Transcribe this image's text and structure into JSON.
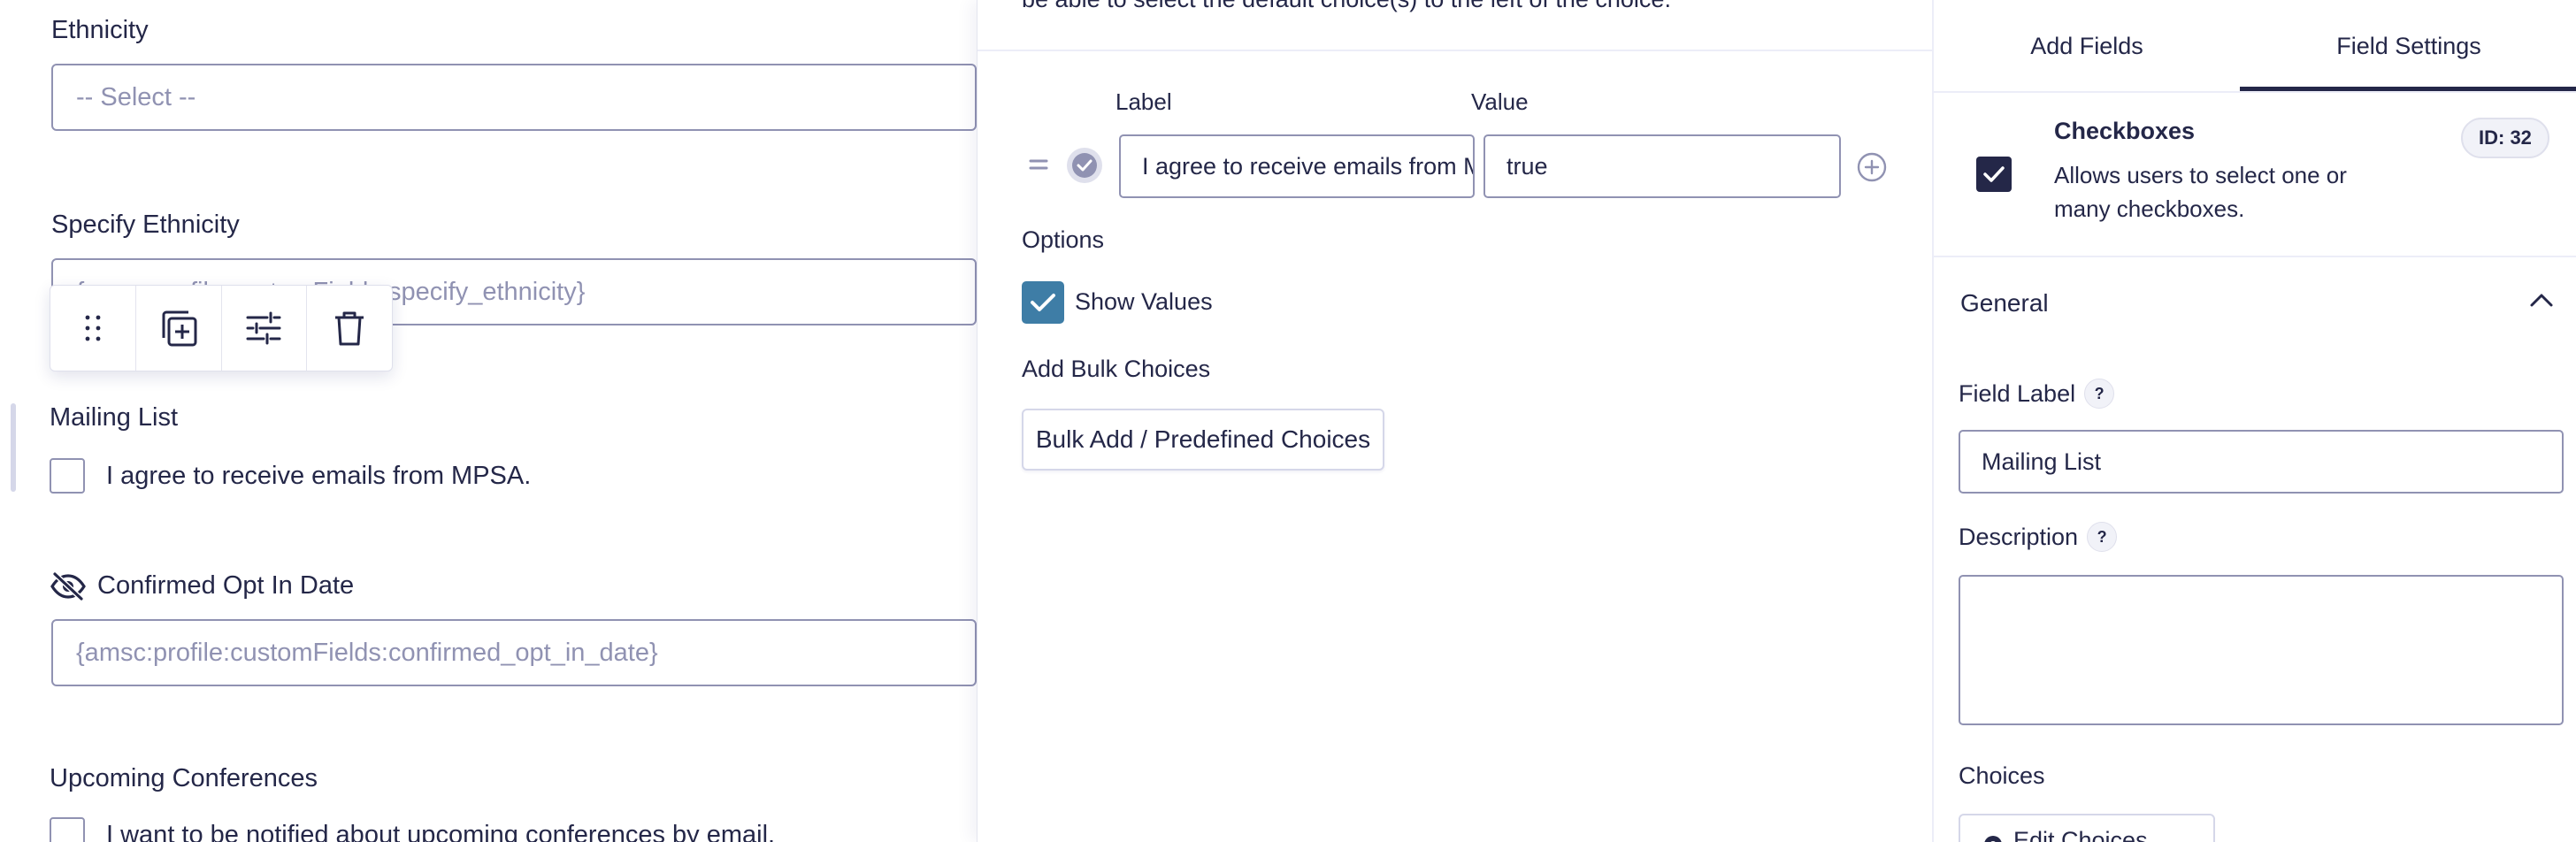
{
  "canvas": {
    "ethnicity": {
      "label": "Ethnicity",
      "placeholder": "-- Select --"
    },
    "specify_ethnicity": {
      "label": "Specify Ethnicity",
      "value": "{amsc:profile:customFields:specify_ethnicity}"
    },
    "mailing_list": {
      "label": "Mailing List",
      "choice": "I agree to receive emails from MPSA."
    },
    "confirmed_opt_in": {
      "label": "Confirmed Opt In Date",
      "value": "{amsc:profile:customFields:confirmed_opt_in_date}"
    },
    "upcoming_conferences": {
      "label": "Upcoming Conferences",
      "choice": "I want to be notified about upcoming conferences by email."
    },
    "toolbar": [
      "drag-handle-icon",
      "duplicate-icon",
      "settings-sliders-icon",
      "trash-icon"
    ]
  },
  "flyout": {
    "intro_text": "be able to select the default choice(s) to the left of the choice.",
    "label_header": "Label",
    "value_header": "Value",
    "choice_label": "I agree to receive emails from MPSA.",
    "choice_value": "true",
    "options_heading": "Options",
    "show_values_label": "Show Values",
    "show_values_checked": true,
    "bulk_heading": "Add Bulk Choices",
    "bulk_button": "Bulk Add / Predefined Choices"
  },
  "sidebar": {
    "tabs": {
      "add_fields": "Add Fields",
      "field_settings": "Field Settings"
    },
    "field_type": {
      "name": "Checkboxes",
      "description": "Allows users to select one or many checkboxes.",
      "id_badge": "ID: 32"
    },
    "general": "General",
    "field_label": {
      "label": "Field Label",
      "help": "?",
      "value": "Mailing List"
    },
    "description": {
      "label": "Description",
      "help": "?",
      "value": ""
    },
    "choices": {
      "label": "Choices",
      "button": "Edit Choices"
    }
  },
  "colors": {
    "primary": "#242748",
    "checkbox_blue": "#3e7da6",
    "border": "#9092b2",
    "choice_dot": "#9092b2"
  }
}
